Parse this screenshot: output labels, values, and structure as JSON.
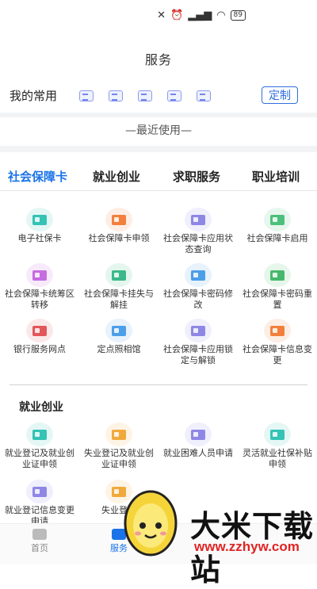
{
  "status_bar": {
    "icons": [
      "mute-icon",
      "alarm-icon",
      "signal-hd-icon",
      "wifi-icon"
    ],
    "battery": "89"
  },
  "header": {
    "title": "服务"
  },
  "favorites": {
    "label": "我的常用",
    "customize_label": "定制",
    "icon_count_visible": 5
  },
  "recent": {
    "label": "—最近使用—"
  },
  "tabs": [
    {
      "label": "社会保障卡",
      "active": true
    },
    {
      "label": "就业创业",
      "active": false
    },
    {
      "label": "求职服务",
      "active": false
    },
    {
      "label": "职业培训",
      "active": false
    }
  ],
  "social_card_items": [
    {
      "label": "电子社保卡",
      "icon": "id-card-icon",
      "color": "#34c3b4"
    },
    {
      "label": "社会保障卡申领",
      "icon": "card-apply-icon",
      "color": "#f2803c"
    },
    {
      "label": "社会保障卡应用状态查询",
      "icon": "card-query-icon",
      "color": "#8f87e6"
    },
    {
      "label": "社会保障卡启用",
      "icon": "card-enable-icon",
      "color": "#4cc07a"
    },
    {
      "label": "社会保障卡统筹区转移",
      "icon": "transfer-icon",
      "color": "#c66be0"
    },
    {
      "label": "社会保障卡挂失与解挂",
      "icon": "card-lock-icon",
      "color": "#3bb98a"
    },
    {
      "label": "社会保障卡密码修改",
      "icon": "password-edit-icon",
      "color": "#4b9ee8"
    },
    {
      "label": "社会保障卡密码重置",
      "icon": "password-reset-icon",
      "color": "#46b86c"
    },
    {
      "label": "银行服务网点",
      "icon": "bank-icon",
      "color": "#e2575a"
    },
    {
      "label": "定点照相馆",
      "icon": "camera-icon",
      "color": "#4b9ee8"
    },
    {
      "label": "社会保障卡应用锁定与解锁",
      "icon": "card-unlock-icon",
      "color": "#8f87e6"
    },
    {
      "label": "社会保障卡信息变更",
      "icon": "info-change-icon",
      "color": "#f2803c"
    }
  ],
  "employment_section": {
    "title": "就业创业",
    "items": [
      {
        "label": "就业登记及就业创业证申领",
        "icon": "register-icon",
        "color": "#34c3b4"
      },
      {
        "label": "失业登记及就业创业证申领",
        "icon": "unemployment-icon",
        "color": "#f2a93c"
      },
      {
        "label": "就业困难人员申请",
        "icon": "hardship-icon",
        "color": "#8f87e6"
      },
      {
        "label": "灵活就业社保补贴申领",
        "icon": "subsidy-icon",
        "color": "#34c3b4"
      },
      {
        "label": "就业登记信息变更申请",
        "icon": "info-update-icon",
        "color": "#8f87e6"
      },
      {
        "label": "失业登记",
        "icon": "unemployment-register-icon",
        "color": "#f2a93c"
      }
    ]
  },
  "bottom_nav": [
    {
      "label": "首页",
      "active": false
    },
    {
      "label": "服务",
      "active": true
    }
  ],
  "watermark": {
    "name": "大米下载站",
    "url": "www.zzhyw.com"
  }
}
